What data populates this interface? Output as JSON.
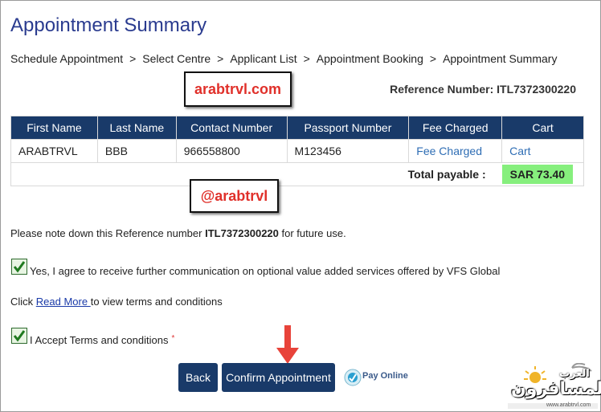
{
  "page": {
    "title": "Appointment Summary",
    "breadcrumb": [
      "Schedule Appointment",
      "Select Centre",
      "Applicant List",
      "Appointment Booking",
      "Appointment Summary"
    ],
    "breadcrumb_separator": ">"
  },
  "watermarks": {
    "top": "arabtrvl.com",
    "middle": "@arabtrvl"
  },
  "reference": {
    "label": "Reference Number:",
    "value": "ITL7372300220"
  },
  "table": {
    "headers": [
      "First Name",
      "Last Name",
      "Contact Number",
      "Passport Number",
      "Fee Charged",
      "Cart"
    ],
    "row": [
      "ARABTRVL",
      "BBB",
      "966558800",
      "M123456",
      "Fee Charged",
      "Cart"
    ],
    "total_label": "Total payable :",
    "total_value": "SAR 73.40"
  },
  "note": {
    "prefix": "Please note down this Reference number ",
    "ref": "ITL7372300220",
    "suffix": " for future use."
  },
  "consent": {
    "checked": true,
    "label": "Yes, I agree to receive further communication on optional value added services offered by VFS Global"
  },
  "terms_line": {
    "prefix": "Click ",
    "link": "Read More ",
    "suffix": "to view terms and conditions"
  },
  "accept": {
    "checked": true,
    "label": "I Accept Terms and conditions",
    "required_mark": "*"
  },
  "buttons": {
    "back": "Back",
    "confirm": "Confirm Appointment",
    "pay_online": "Pay Online"
  },
  "logo": {
    "arabic_main": "المسافرون",
    "arabic_small": "العرب",
    "site": "www.arabtrvl.com"
  },
  "colors": {
    "header_bg": "#193a69",
    "title": "#2a3b8f",
    "total_bg": "#86ef7d",
    "watermark_text": "#e0302a",
    "arrow": "#e8433a"
  }
}
